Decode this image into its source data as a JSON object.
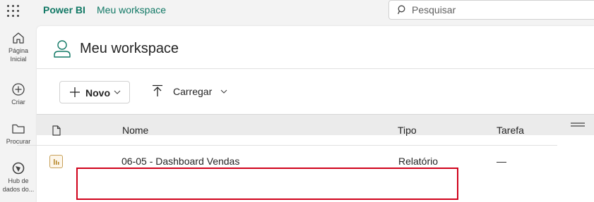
{
  "app": {
    "brand": "Power BI",
    "breadcrumb": "Meu workspace"
  },
  "search": {
    "placeholder": "Pesquisar"
  },
  "leftnav": {
    "items": [
      {
        "label_line1": "Página",
        "label_line2": "Inicial",
        "icon": "home-icon"
      },
      {
        "label_line1": "Criar",
        "label_line2": "",
        "icon": "plus-circle-icon"
      },
      {
        "label_line1": "Procurar",
        "label_line2": "",
        "icon": "folder-icon"
      },
      {
        "label_line1": "Hub de",
        "label_line2": "dados do...",
        "icon": "data-hub-icon"
      }
    ]
  },
  "workspace": {
    "title": "Meu workspace",
    "icon": "person-icon"
  },
  "toolbar": {
    "new_label": "Novo",
    "upload_label": "Carregar"
  },
  "table": {
    "columns": {
      "type_icon": "document-icon",
      "name": "Nome",
      "kind": "Tipo",
      "task": "Tarefa"
    },
    "rows": [
      {
        "name": "06-05 - Dashboard Vendas",
        "kind": "Relatório",
        "task": "—",
        "icon": "report-icon"
      }
    ]
  },
  "colors": {
    "brand": "#117865",
    "highlight": "#d0021b",
    "report_icon": "#b88a2e"
  }
}
